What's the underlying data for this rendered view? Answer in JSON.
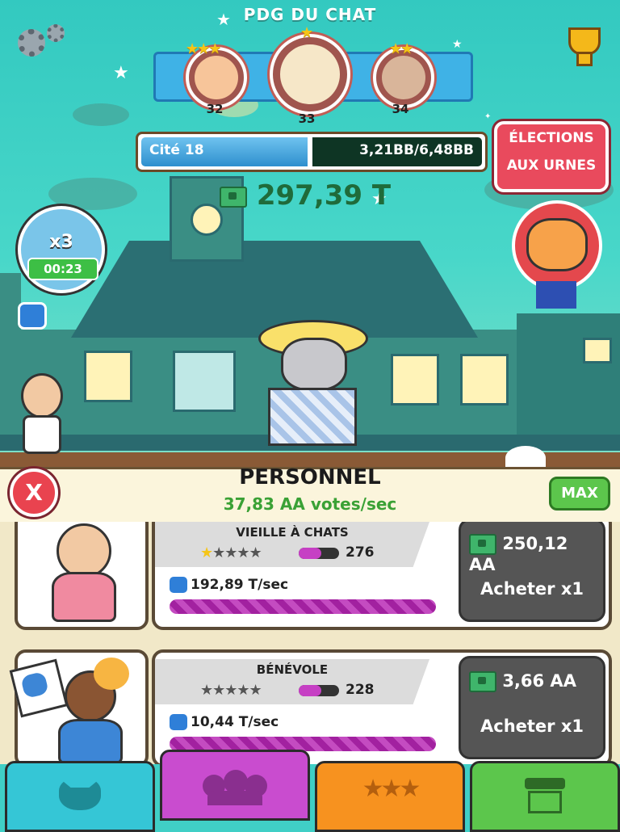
{
  "header": {
    "title": "PDG DU CHAT",
    "ranks": [
      {
        "num": "32",
        "stars": "★★★"
      },
      {
        "num": "33",
        "stars": "★"
      },
      {
        "num": "34",
        "stars": "★★"
      }
    ]
  },
  "city_progress": {
    "city": "Cité 18",
    "value": "3,21BB/6,48BB",
    "fraction": 0.4955
  },
  "elections_button": {
    "line1": "ÉLECTIONS",
    "line2": "AUX URNES"
  },
  "money": {
    "amount": "297,39 T"
  },
  "boost": {
    "multiplier": "x3",
    "time": "00:23"
  },
  "panel": {
    "title": "PERSONNEL",
    "rate": "37,83 AA votes/sec",
    "max_label": "MAX",
    "close_label": "X"
  },
  "staff": [
    {
      "name": "VIEILLE À CHATS",
      "stars_filled": 1,
      "stars_total": 5,
      "level": "276",
      "level_fill": 0.55,
      "rate": "192,89 T/sec",
      "price": "250,12 AA",
      "buy_label": "Acheter x1"
    },
    {
      "name": "BÉNÉVOLE",
      "stars_filled": 0,
      "stars_total": 5,
      "level": "228",
      "level_fill": 0.55,
      "rate": "10,44 T/sec",
      "price": "3,66 AA",
      "buy_label": "Acheter x1"
    }
  ],
  "tabs": [
    {
      "name": "cats",
      "color": "#35c6d6"
    },
    {
      "name": "staff",
      "color": "#c94ccf"
    },
    {
      "name": "upgrades",
      "color": "#f7921f"
    },
    {
      "name": "shop",
      "color": "#5cc64c"
    }
  ],
  "colors": {
    "accent_red": "#e94a5d",
    "money_green": "#1f6b3a",
    "rate_green": "#3aa135"
  }
}
